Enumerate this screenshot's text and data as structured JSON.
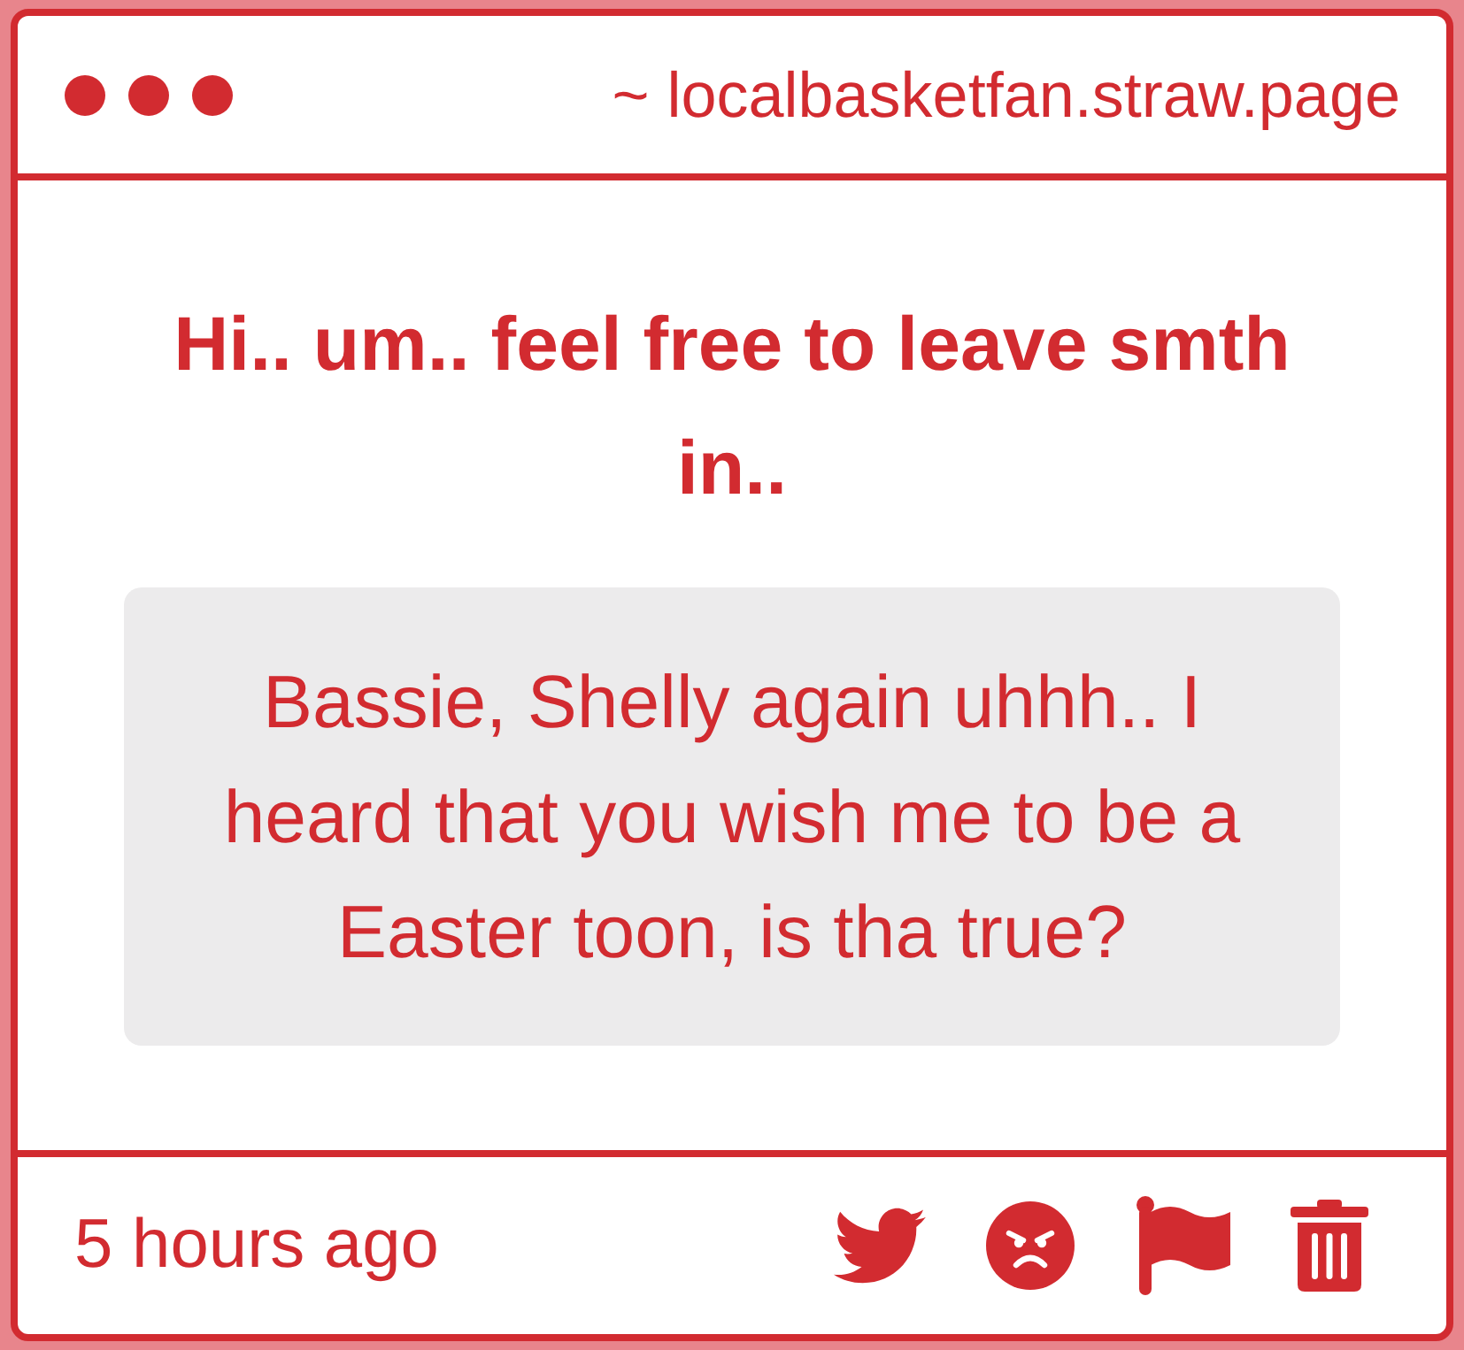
{
  "header": {
    "url": "~ localbasketfan.straw.page"
  },
  "prompt": "Hi.. um.. feel free to leave smth in..",
  "message": "Bassie, Shelly again uhhh.. I heard that you wish me to be a Easter toon, is tha true?",
  "footer": {
    "time": "5 hours ago",
    "actions": [
      {
        "kind": "twitter"
      },
      {
        "kind": "angry"
      },
      {
        "kind": "flag"
      },
      {
        "kind": "delete"
      }
    ]
  }
}
